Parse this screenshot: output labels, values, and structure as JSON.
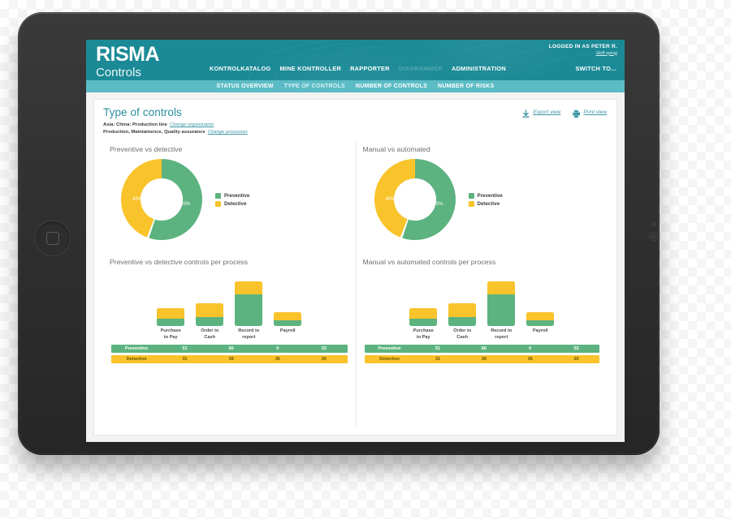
{
  "app": {
    "brand_line1": "RISMA",
    "brand_line2": "Controls"
  },
  "header": {
    "logged_in_text": "LOGGED IN AS PETER R.",
    "change_language_link": "Skift sprog",
    "switch_to_label": "SWITCH TO...",
    "main_nav": [
      {
        "label": "KONTROLKATALOG",
        "state": "normal"
      },
      {
        "label": "MINE KONTROLLER",
        "state": "normal"
      },
      {
        "label": "RAPPORTER",
        "state": "normal"
      },
      {
        "label": "DIAGRAMMER",
        "state": "dim"
      },
      {
        "label": "ADMINISTRATION",
        "state": "normal"
      }
    ],
    "sub_nav": [
      {
        "label": "STATUS OVERVIEW",
        "active": false
      },
      {
        "label": "TYPE OF CONTROLS",
        "active": true
      },
      {
        "label": "NUMBER OF CONTROLS",
        "active": false
      },
      {
        "label": "NUMBER OF RISKS",
        "active": false
      }
    ]
  },
  "page": {
    "title": "Type of controls",
    "organisation_text": "Asia: China: Production line",
    "organisation_link": "Change organisation",
    "processes_text": "Production, Maintainence, Quality assurance",
    "processes_link": "Change processes",
    "export_label": "Export view",
    "print_label": "Print view"
  },
  "colors": {
    "brand_teal": "#1b8a96",
    "subnav_teal": "#5cbcc6",
    "green": "#5cb37f",
    "yellow": "#f9c32b",
    "title_teal": "#2a8f9d",
    "link_teal": "#3d97a4"
  },
  "legend": [
    {
      "label": "Preventive",
      "color": "#5cb37f"
    },
    {
      "label": "Detective",
      "color": "#f9c32b"
    }
  ],
  "chart_data": [
    {
      "type": "pie",
      "id": "donut-preventive-vs-detective",
      "title": "Preventive vs detective",
      "labels": [
        "Preventive",
        "Detective"
      ],
      "values": [
        55,
        45
      ],
      "value_labels": [
        "55%",
        "45%"
      ],
      "colors": [
        "#5cb37f",
        "#f9c32b"
      ],
      "donut": true,
      "legend_position": "right"
    },
    {
      "type": "pie",
      "id": "donut-manual-vs-automated",
      "title": "Manual vs automated",
      "labels": [
        "Preventive",
        "Detective"
      ],
      "values": [
        55,
        45
      ],
      "value_labels": [
        "55%",
        "45%"
      ],
      "colors": [
        "#5cb37f",
        "#f9c32b"
      ],
      "donut": true,
      "legend_position": "right"
    },
    {
      "type": "bar",
      "id": "bars-preventive-vs-detective-per-process",
      "title": "Preventive vs detective controls per process",
      "stacked": true,
      "categories": [
        "Purchase to Pay",
        "Order to Cash",
        "Record to report",
        "Payroll"
      ],
      "series": [
        {
          "name": "Preventive",
          "color": "#5cb37f",
          "values": [
            51,
            66,
            0,
            52
          ]
        },
        {
          "name": "Detective",
          "color": "#f9c32b",
          "values": [
            31,
            39,
            35,
            20
          ]
        }
      ],
      "ylabel": "",
      "xlabel": "",
      "grid": false
    },
    {
      "type": "bar",
      "id": "bars-manual-vs-automated-per-process",
      "title": "Manual vs automated controls per process",
      "stacked": true,
      "categories": [
        "Purchase to Pay",
        "Order to Cash",
        "Record to report",
        "Payroll"
      ],
      "series": [
        {
          "name": "Preventive",
          "color": "#5cb37f",
          "values": [
            51,
            66,
            0,
            52
          ]
        },
        {
          "name": "Detective",
          "color": "#f9c32b",
          "values": [
            31,
            39,
            35,
            20
          ]
        }
      ],
      "ylabel": "",
      "xlabel": "",
      "grid": false
    }
  ],
  "bar_labels": {
    "cat0_l1": "Purchase",
    "cat0_l2": "to Pay",
    "cat1_l1": "Order to Cash",
    "cat1_l2": "",
    "cat2_l1": "Record to",
    "cat2_l2": "report",
    "cat3_l1": "Payroll",
    "cat3_l2": ""
  },
  "table": {
    "rows": [
      {
        "name": "Preventive",
        "values": [
          "51",
          "66",
          "0",
          "52"
        ]
      },
      {
        "name": "Detective",
        "values": [
          "31",
          "39",
          "35",
          "20"
        ]
      }
    ]
  }
}
